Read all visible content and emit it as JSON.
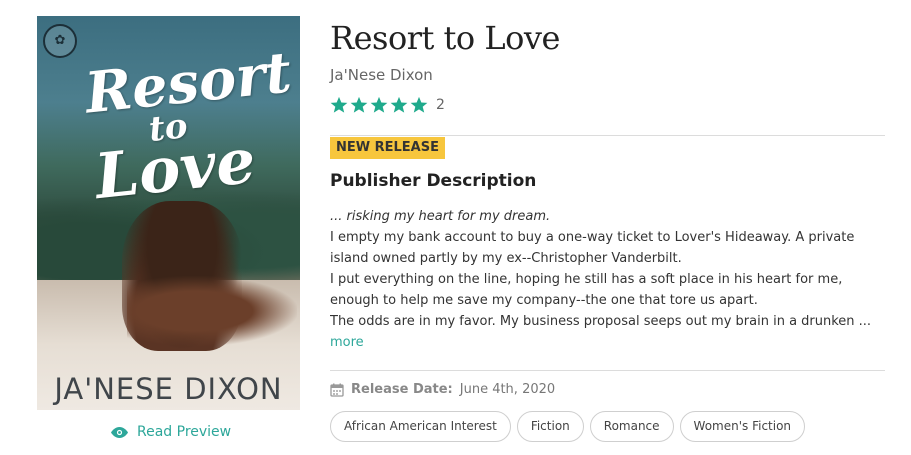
{
  "cover": {
    "title_line1": "Resort",
    "title_line2": "to",
    "title_line3": "Love",
    "author": "JA'NESE DIXON",
    "badge_icon": "publisher-logo-icon"
  },
  "preview": {
    "label": "Read Preview",
    "icon": "eye-icon",
    "color": "#2da79a"
  },
  "book": {
    "title": "Resort to Love",
    "author": "Ja'Nese Dixon",
    "rating": 5,
    "rating_count": "2",
    "star_color": "#1faa8c"
  },
  "badge": {
    "label": "NEW RELEASE",
    "color": "#f7c63d"
  },
  "description": {
    "heading": "Publisher Description",
    "lead": "... risking my heart for my dream.",
    "lines": [
      "I empty my bank account to buy a one-way ticket to Lover's Hideaway. A private",
      "island owned partly by my ex--Christopher Vanderbilt.",
      "I put everything on the line, hoping he still has a soft place in his heart for me,",
      "enough to help me save my company--the one that tore us apart.",
      "The odds are in my favor. My business proposal seeps out my brain in a drunken ..."
    ],
    "more_label": "more"
  },
  "release": {
    "icon": "calendar-icon",
    "label": "Release Date:",
    "value": "June 4th, 2020"
  },
  "tags": [
    "African American Interest",
    "Fiction",
    "Romance",
    "Women's Fiction"
  ]
}
